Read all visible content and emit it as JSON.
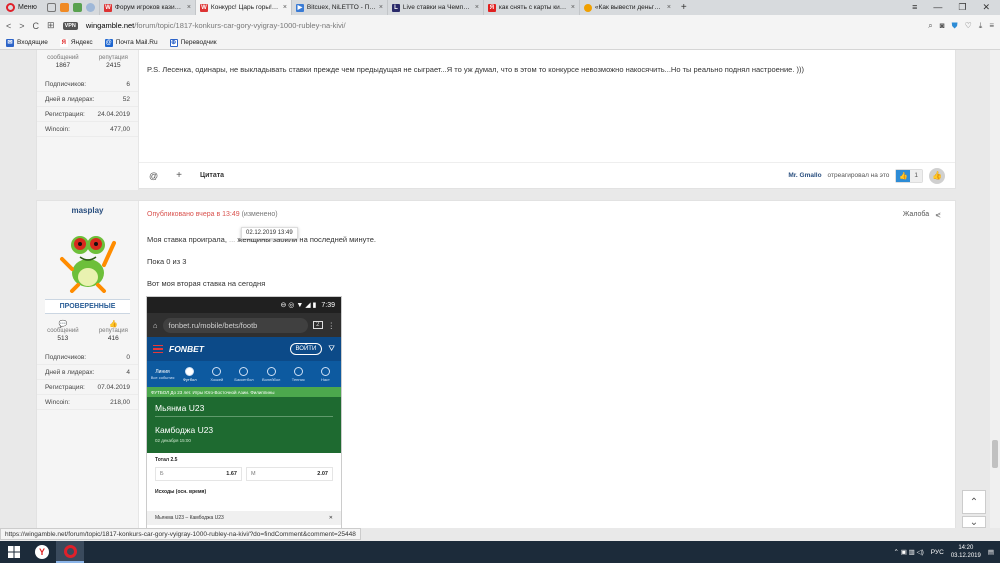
{
  "browser": {
    "menu_label": "Меню",
    "tabs": [
      {
        "title": "Форум игроков казино - ",
        "color": "#d33",
        "glyph": "W"
      },
      {
        "title": "Конкурс! Царь горы! Вы...",
        "color": "#d33",
        "glyph": "W",
        "active": true
      },
      {
        "title": "Bitcuex, NiLETTO - Пол-ю...",
        "color": "#3a7bd5",
        "glyph": "B"
      },
      {
        "title": "Live ставки на Чемпионат ",
        "color": "#2a2a6a",
        "glyph": "L"
      },
      {
        "title": "как снять с карты киви б...",
        "color": "#e02020",
        "glyph": "Я"
      },
      {
        "title": "«Как вывести деньги с ки...",
        "color": "#f0a000",
        "glyph": "•"
      }
    ],
    "url_host": "wingamble.net",
    "url_path": "/forum/topic/1817-konkurs-car-gory-vyigray-1000-rubley-na-kivi/",
    "vpn_label": "VPN",
    "bookmarks": [
      "Входящие",
      "Яндекс",
      "Почта Mail.Ru",
      "Переводчик"
    ]
  },
  "post1": {
    "stats": {
      "posts_label": "сообщений",
      "posts": "1867",
      "rep_label": "репутация",
      "rep": "2415"
    },
    "info": [
      {
        "label": "Подписчиков:",
        "value": "6"
      },
      {
        "label": "Дней в лидерах:",
        "value": "52"
      },
      {
        "label": "Регистрация:",
        "value": "24.04.2019"
      },
      {
        "label": "Wincoin:",
        "value": "477,00"
      }
    ],
    "text": "P.S. Лесенка, одинары, не выкладывать ставки прежде чем предыдущая не сыграет...Я то уж думал, что в этом то конкурсе невозможно накосячить...Но ты реально поднял настроение. )))",
    "footer": {
      "mention_icon": "@",
      "plus_icon": "+",
      "quote_label": "Цитата",
      "reactor": "Mr. Gmallo",
      "reacted_text": "отреагировал на это",
      "like_count": "1"
    }
  },
  "post2": {
    "username": "masplay",
    "badge": "ПРОВЕРЕННЫЕ",
    "stats": {
      "posts_label": "сообщений",
      "posts": "513",
      "rep_label": "репутация",
      "rep": "416"
    },
    "info": [
      {
        "label": "Подписчиков:",
        "value": "0"
      },
      {
        "label": "Дней в лидерах:",
        "value": "4"
      },
      {
        "label": "Регистрация:",
        "value": "07.04.2019"
      },
      {
        "label": "Wincoin:",
        "value": "218,00"
      }
    ],
    "published": "Опубликовано вчера в 13:49",
    "edited": "(изменено)",
    "report_label": "Жалоба",
    "tooltip": "02.12.2019 13:49",
    "line1_a": "Моя ставка проиграла,",
    "line1_b": "женщины забили на последней минуте.",
    "line2": "Пока 0 из 3",
    "line3": "Вот моя вторая ставка на сегодня"
  },
  "phone": {
    "time": "7:39",
    "url": "fonbet.ru/mobile/bets/footb",
    "tab_count": "2",
    "brand": "FONBET",
    "login": "ВОЙТИ",
    "categories": [
      "Все события",
      "Футбол",
      "Хоккей",
      "Баскетбол",
      "Волейбол",
      "Теннис",
      "Наст"
    ],
    "line_label": "Линия",
    "league": "ФУТБОЛ До 23 лет. Игры Юго-Восточной Азии. Филиппины",
    "team1": "Мьянма U23",
    "team2": "Камбоджа U23",
    "match_date": "02 декабря 15:00",
    "total_label": "Тотал 2.5",
    "odds": [
      {
        "k": "Б",
        "v": "1.67"
      },
      {
        "k": "М",
        "v": "2.07"
      }
    ],
    "outcomes_label": "Исходы (осн. время)",
    "bet_slip": "Мьянма U23 – Камбоджа U23"
  },
  "status_url": "https://wingamble.net/forum/topic/1817-konkurs-car-gory-vyigray-1000-rubley-na-kivi/?do=findComment&comment=25448",
  "taskbar": {
    "lang": "РУС",
    "time": "14:20",
    "date": "03.12.2019"
  }
}
